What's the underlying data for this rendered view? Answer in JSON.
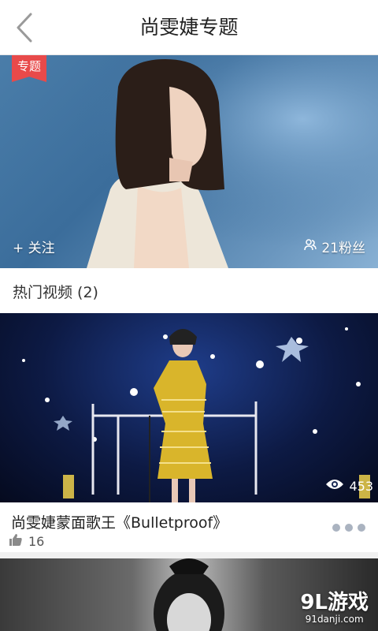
{
  "header": {
    "title": "尚雯婕专题"
  },
  "banner": {
    "badge": "专题",
    "follow_label": "+ 关注",
    "fans_label": "21粉丝"
  },
  "section": {
    "title": "热门视频 (2)"
  },
  "videos": [
    {
      "title": "尚雯婕蒙面歌王《Bulletproof》",
      "views": "453",
      "likes": "16"
    }
  ],
  "watermark": {
    "main": "9L游戏",
    "sub": "91danji.com"
  },
  "colors": {
    "badge": "#e84a4a",
    "more_dots": "#aab3c0"
  }
}
